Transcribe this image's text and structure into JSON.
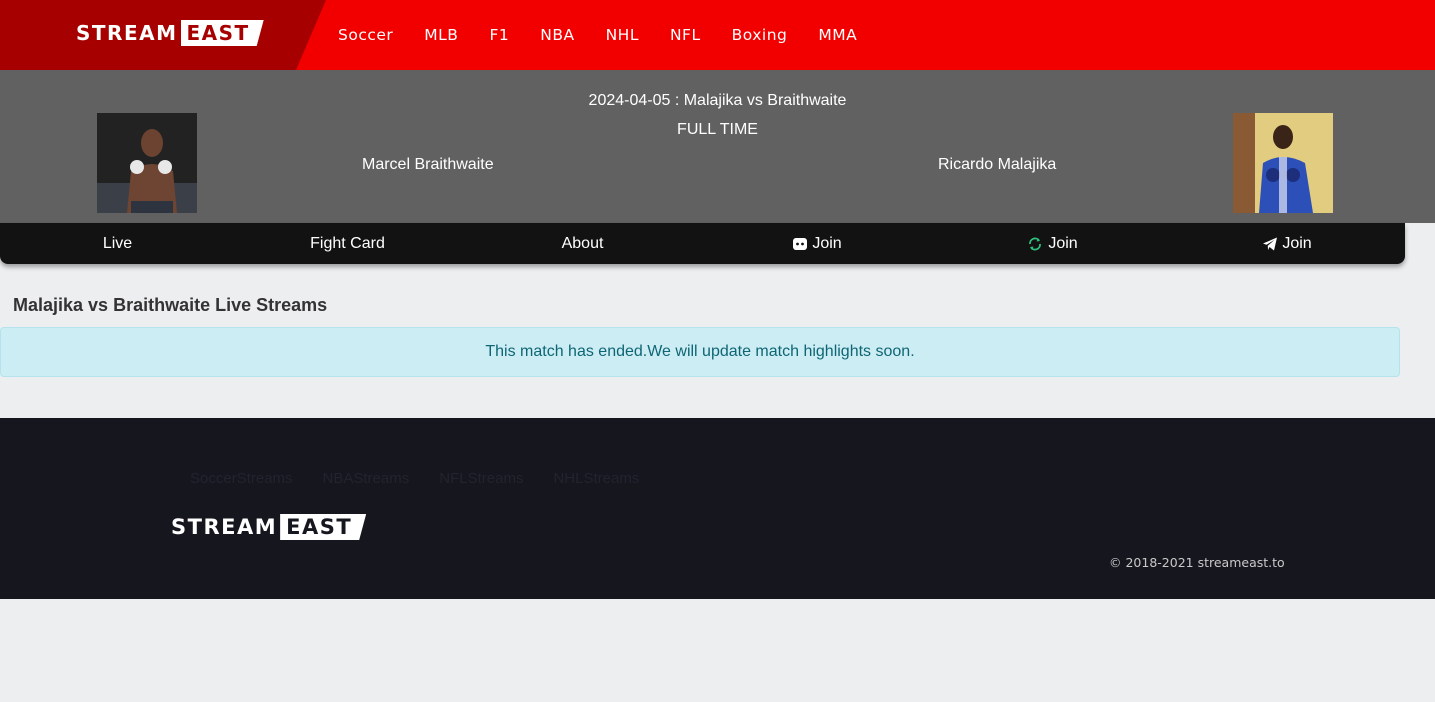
{
  "brand": {
    "part1": "STREAM",
    "part2": "EAST"
  },
  "nav": [
    "Soccer",
    "MLB",
    "F1",
    "NBA",
    "NHL",
    "NFL",
    "Boxing",
    "MMA"
  ],
  "match": {
    "title": "2024-04-05 : Malajika vs Braithwaite",
    "status": "FULL TIME",
    "fighter_left": "Marcel Braithwaite",
    "fighter_right": "Ricardo Malajika"
  },
  "tabs": {
    "live": "Live",
    "fight_card": "Fight Card",
    "about": "About",
    "discord": "Join",
    "reddit": "Join",
    "telegram": "Join"
  },
  "content": {
    "heading": "Malajika vs Braithwaite Live Streams",
    "alert": "This match has ended.We will update match highlights soon."
  },
  "footer": {
    "links": [
      "SoccerStreams",
      "NBAStreams",
      "NFLStreams",
      "NHLStreams"
    ],
    "copyright": "© 2018-2021 streameast.to"
  },
  "colors": {
    "topbar": "#f20000",
    "logo_bg": "#a60000",
    "match_bg": "#616161",
    "tabs_bg": "#121212",
    "alert_bg": "#cdedf4",
    "footer_bg": "#16161f"
  },
  "icons": [
    "discord-icon",
    "reddit-icon",
    "telegram-icon"
  ]
}
